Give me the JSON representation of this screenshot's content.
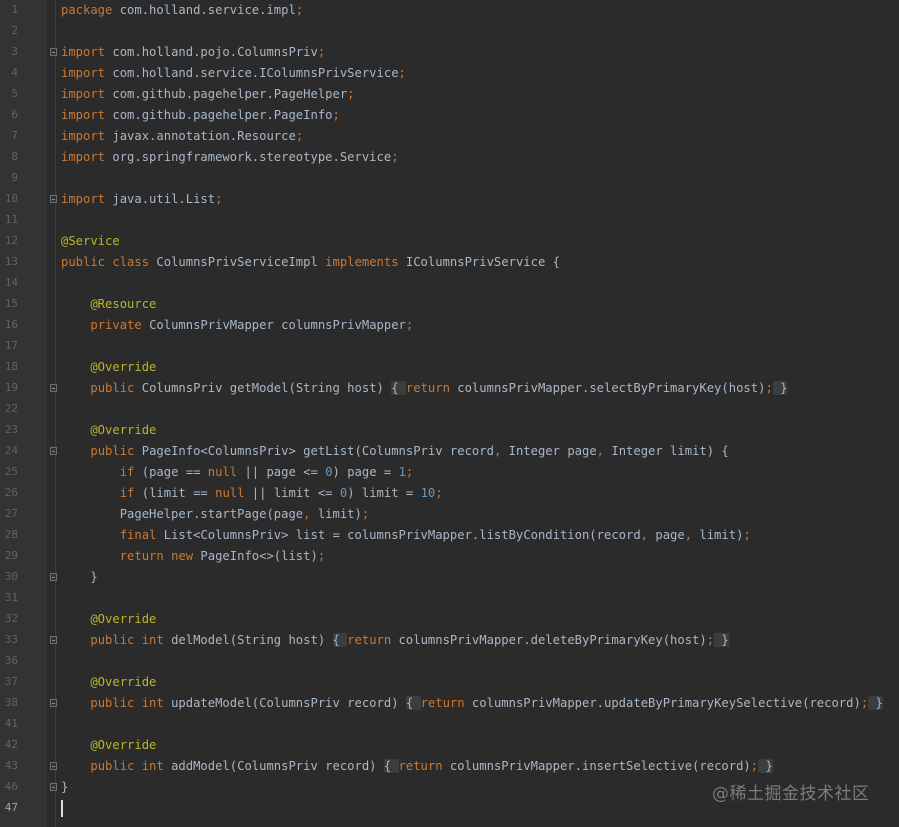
{
  "editor": {
    "lines": [
      {
        "n": "1",
        "tokens": [
          {
            "t": "package",
            "c": "kw"
          },
          {
            "t": " com.holland.service.impl",
            "c": ""
          },
          {
            "t": ";",
            "c": "kw"
          }
        ]
      },
      {
        "n": "2",
        "tokens": []
      },
      {
        "n": "3",
        "fold": true,
        "tokens": [
          {
            "t": "import",
            "c": "kw"
          },
          {
            "t": " com.holland.pojo.ColumnsPriv",
            "c": ""
          },
          {
            "t": ";",
            "c": "kw"
          }
        ]
      },
      {
        "n": "4",
        "tokens": [
          {
            "t": "import",
            "c": "kw"
          },
          {
            "t": " com.holland.service.IColumnsPrivService",
            "c": ""
          },
          {
            "t": ";",
            "c": "kw"
          }
        ]
      },
      {
        "n": "5",
        "tokens": [
          {
            "t": "import",
            "c": "kw"
          },
          {
            "t": " com.github.pagehelper.PageHelper",
            "c": ""
          },
          {
            "t": ";",
            "c": "kw"
          }
        ]
      },
      {
        "n": "6",
        "tokens": [
          {
            "t": "import",
            "c": "kw"
          },
          {
            "t": " com.github.pagehelper.PageInfo",
            "c": ""
          },
          {
            "t": ";",
            "c": "kw"
          }
        ]
      },
      {
        "n": "7",
        "tokens": [
          {
            "t": "import",
            "c": "kw"
          },
          {
            "t": " javax.annotation.Resource",
            "c": ""
          },
          {
            "t": ";",
            "c": "kw"
          }
        ]
      },
      {
        "n": "8",
        "tokens": [
          {
            "t": "import",
            "c": "kw"
          },
          {
            "t": " org.springframework.stereotype.Service",
            "c": ""
          },
          {
            "t": ";",
            "c": "kw"
          }
        ]
      },
      {
        "n": "9",
        "tokens": []
      },
      {
        "n": "10",
        "fold": true,
        "tokens": [
          {
            "t": "import",
            "c": "kw"
          },
          {
            "t": " java.util.List",
            "c": ""
          },
          {
            "t": ";",
            "c": "kw"
          }
        ]
      },
      {
        "n": "11",
        "tokens": []
      },
      {
        "n": "12",
        "tokens": [
          {
            "t": "@Service",
            "c": "an"
          }
        ]
      },
      {
        "n": "13",
        "tokens": [
          {
            "t": "public class",
            "c": "kw"
          },
          {
            "t": " ColumnsPrivServiceImpl ",
            "c": ""
          },
          {
            "t": "implements",
            "c": "kw"
          },
          {
            "t": " IColumnsPrivService {",
            "c": ""
          }
        ]
      },
      {
        "n": "14",
        "tokens": []
      },
      {
        "n": "15",
        "tokens": [
          {
            "t": "    @Resource",
            "c": "an"
          }
        ]
      },
      {
        "n": "16",
        "tokens": [
          {
            "t": "    ",
            "c": ""
          },
          {
            "t": "private",
            "c": "kw"
          },
          {
            "t": " ColumnsPrivMapper columnsPrivMapper",
            "c": ""
          },
          {
            "t": ";",
            "c": "kw"
          }
        ]
      },
      {
        "n": "17",
        "tokens": []
      },
      {
        "n": "18",
        "tokens": [
          {
            "t": "    @Override",
            "c": "an"
          }
        ]
      },
      {
        "n": "19",
        "fold": true,
        "tokens": [
          {
            "t": "    ",
            "c": ""
          },
          {
            "t": "public",
            "c": "kw"
          },
          {
            "t": " ColumnsPriv getModel(String host) ",
            "c": ""
          },
          {
            "t": "{ ",
            "c": "br"
          },
          {
            "t": "return",
            "c": "kw"
          },
          {
            "t": " columnsPrivMapper.selectByPrimaryKey(host)",
            "c": ""
          },
          {
            "t": ";",
            "c": "kw"
          },
          {
            "t": " }",
            "c": "br"
          }
        ]
      },
      {
        "n": "22",
        "tokens": []
      },
      {
        "n": "23",
        "tokens": [
          {
            "t": "    @Override",
            "c": "an"
          }
        ]
      },
      {
        "n": "24",
        "fold": true,
        "tokens": [
          {
            "t": "    ",
            "c": ""
          },
          {
            "t": "public",
            "c": "kw"
          },
          {
            "t": " PageInfo<ColumnsPriv> getList(ColumnsPriv record",
            "c": ""
          },
          {
            "t": ",",
            "c": "kw"
          },
          {
            "t": " Integer page",
            "c": ""
          },
          {
            "t": ",",
            "c": "kw"
          },
          {
            "t": " Integer limit) {",
            "c": ""
          }
        ]
      },
      {
        "n": "25",
        "tokens": [
          {
            "t": "        ",
            "c": ""
          },
          {
            "t": "if",
            "c": "kw"
          },
          {
            "t": " (page == ",
            "c": ""
          },
          {
            "t": "null",
            "c": "kw"
          },
          {
            "t": " || page <= ",
            "c": ""
          },
          {
            "t": "0",
            "c": "num"
          },
          {
            "t": ") page = ",
            "c": ""
          },
          {
            "t": "1",
            "c": "num"
          },
          {
            "t": ";",
            "c": "kw"
          }
        ]
      },
      {
        "n": "26",
        "tokens": [
          {
            "t": "        ",
            "c": ""
          },
          {
            "t": "if",
            "c": "kw"
          },
          {
            "t": " (limit == ",
            "c": ""
          },
          {
            "t": "null",
            "c": "kw"
          },
          {
            "t": " || limit <= ",
            "c": ""
          },
          {
            "t": "0",
            "c": "num"
          },
          {
            "t": ") limit = ",
            "c": ""
          },
          {
            "t": "10",
            "c": "num"
          },
          {
            "t": ";",
            "c": "kw"
          }
        ]
      },
      {
        "n": "27",
        "tokens": [
          {
            "t": "        PageHelper.startPage(page",
            "c": ""
          },
          {
            "t": ",",
            "c": "kw"
          },
          {
            "t": " limit)",
            "c": ""
          },
          {
            "t": ";",
            "c": "kw"
          }
        ]
      },
      {
        "n": "28",
        "tokens": [
          {
            "t": "        ",
            "c": ""
          },
          {
            "t": "final",
            "c": "kw"
          },
          {
            "t": " List<ColumnsPriv> list = columnsPrivMapper.listByCondition(record",
            "c": ""
          },
          {
            "t": ",",
            "c": "kw"
          },
          {
            "t": " page",
            "c": ""
          },
          {
            "t": ",",
            "c": "kw"
          },
          {
            "t": " limit)",
            "c": ""
          },
          {
            "t": ";",
            "c": "kw"
          }
        ]
      },
      {
        "n": "29",
        "tokens": [
          {
            "t": "        ",
            "c": ""
          },
          {
            "t": "return new",
            "c": "kw"
          },
          {
            "t": " PageInfo<>(list)",
            "c": ""
          },
          {
            "t": ";",
            "c": "kw"
          }
        ]
      },
      {
        "n": "30",
        "fold": true,
        "tokens": [
          {
            "t": "    }",
            "c": ""
          }
        ]
      },
      {
        "n": "31",
        "tokens": []
      },
      {
        "n": "32",
        "tokens": [
          {
            "t": "    @Override",
            "c": "an"
          }
        ]
      },
      {
        "n": "33",
        "fold": true,
        "tokens": [
          {
            "t": "    ",
            "c": ""
          },
          {
            "t": "public int",
            "c": "kw"
          },
          {
            "t": " delModel(String host) ",
            "c": ""
          },
          {
            "t": "{ ",
            "c": "br"
          },
          {
            "t": "return",
            "c": "kw"
          },
          {
            "t": " columnsPrivMapper.deleteByPrimaryKey(host)",
            "c": ""
          },
          {
            "t": ";",
            "c": "kw"
          },
          {
            "t": " }",
            "c": "br"
          }
        ]
      },
      {
        "n": "36",
        "tokens": []
      },
      {
        "n": "37",
        "tokens": [
          {
            "t": "    @Override",
            "c": "an"
          }
        ]
      },
      {
        "n": "38",
        "fold": true,
        "tokens": [
          {
            "t": "    ",
            "c": ""
          },
          {
            "t": "public int",
            "c": "kw"
          },
          {
            "t": " updateModel(ColumnsPriv record) ",
            "c": ""
          },
          {
            "t": "{ ",
            "c": "br"
          },
          {
            "t": "return",
            "c": "kw"
          },
          {
            "t": " columnsPrivMapper.updateByPrimaryKeySelective(record)",
            "c": ""
          },
          {
            "t": ";",
            "c": "kw"
          },
          {
            "t": " }",
            "c": "br"
          }
        ]
      },
      {
        "n": "41",
        "tokens": []
      },
      {
        "n": "42",
        "tokens": [
          {
            "t": "    @Override",
            "c": "an"
          }
        ]
      },
      {
        "n": "43",
        "fold": true,
        "tokens": [
          {
            "t": "    ",
            "c": ""
          },
          {
            "t": "public int",
            "c": "kw"
          },
          {
            "t": " addModel(ColumnsPriv record) ",
            "c": ""
          },
          {
            "t": "{ ",
            "c": "br"
          },
          {
            "t": "return",
            "c": "kw"
          },
          {
            "t": " columnsPrivMapper.insertSelective(record)",
            "c": ""
          },
          {
            "t": ";",
            "c": "kw"
          },
          {
            "t": " }",
            "c": "br"
          }
        ]
      },
      {
        "n": "46",
        "fold": true,
        "tokens": [
          {
            "t": "}",
            "c": ""
          }
        ]
      },
      {
        "n": "47",
        "current": true,
        "tokens": []
      }
    ]
  },
  "watermark": "@稀土掘金技术社区",
  "colors": {
    "background": "#2b2b2b",
    "gutter": "#313335",
    "keyword": "#cc7832",
    "annotation": "#bbb529",
    "number": "#6897bb",
    "text": "#a9b7c6",
    "line_number": "#606366"
  }
}
